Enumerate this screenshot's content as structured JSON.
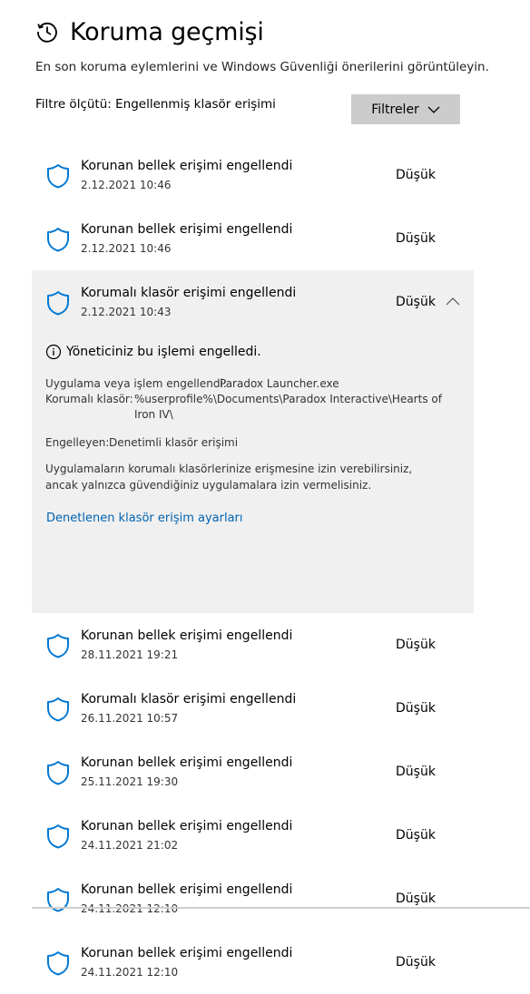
{
  "page": {
    "title": "Koruma geçmişi",
    "subtitle": "En son koruma eylemlerini ve Windows Güvenliği önerilerini görüntüleyin.",
    "filter_label": "Filtre ölçütü: Engellenmiş klasör erişimi",
    "filter_button": "Filtreler"
  },
  "items_top": [
    {
      "title": "Korunan bellek erişimi engellendi",
      "date": "2.12.2021 10:46",
      "severity": "Düşük"
    },
    {
      "title": "Korunan bellek erişimi engellendi",
      "date": "2.12.2021 10:46",
      "severity": "Düşük"
    }
  ],
  "expanded": {
    "title": "Korumalı klasör erişimi engellendi",
    "date": "2.12.2021 10:43",
    "severity": "Düşük",
    "info": "Yöneticiniz bu işlemi engelledi.",
    "app_label": "Uygulama veya işlem engellendi:",
    "app_value": "Paradox Launcher.exe",
    "folder_label": "Korumalı klasör:",
    "folder_value": "%userprofile%\\Documents\\Paradox Interactive\\Hearts of Iron IV\\",
    "blocked_by_label": "Engelleyen:",
    "blocked_by_value": "Denetimli klasör erişimi",
    "description": "Uygulamaların korumalı klasörlerinize erişmesine izin verebilirsiniz, ancak yalnızca güvendiğiniz uygulamalara izin vermelisiniz.",
    "link": "Denetlenen klasör erişim ayarları"
  },
  "items_bottom": [
    {
      "title": "Korunan bellek erişimi engellendi",
      "date": "28.11.2021 19:21",
      "severity": "Düşük"
    },
    {
      "title": "Korumalı klasör erişimi engellendi",
      "date": "26.11.2021 10:57",
      "severity": "Düşük"
    },
    {
      "title": "Korunan bellek erişimi engellendi",
      "date": "25.11.2021 19:30",
      "severity": "Düşük"
    },
    {
      "title": "Korunan bellek erişimi engellendi",
      "date": "24.11.2021 21:02",
      "severity": "Düşük"
    },
    {
      "title": "Korunan bellek erişimi engellendi",
      "date": "24.11.2021 12:10",
      "severity": "Düşük"
    },
    {
      "title": "Korunan bellek erişimi engellendi",
      "date": "24.11.2021 12:10",
      "severity": "Düşük"
    }
  ],
  "icons": {
    "history": "history-clock-icon",
    "shield": "shield-icon",
    "info": "info-icon",
    "chevron_down": "chevron-down-icon",
    "chevron_up": "chevron-up-icon"
  },
  "colors": {
    "accent": "#0063b1",
    "shield_stroke": "#0078d4",
    "expanded_bg": "#f0f0f0",
    "button_bg": "#cccccc"
  }
}
